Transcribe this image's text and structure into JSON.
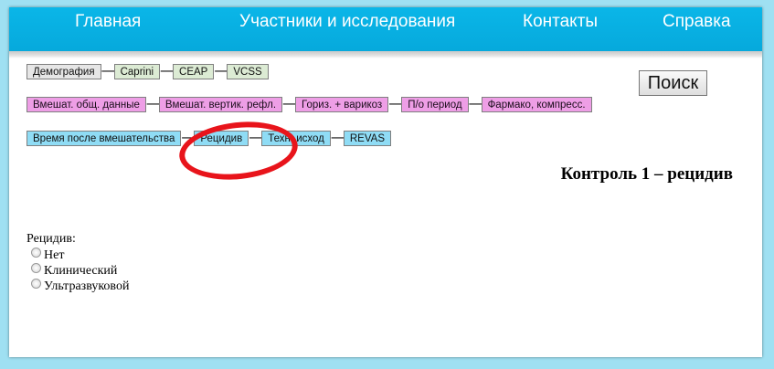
{
  "nav": {
    "items": [
      "Главная",
      "Участники и исследования",
      "Контакты",
      "Справка"
    ]
  },
  "breadcrumbs": {
    "row1": [
      "Демография",
      "Caprini",
      "CEAP",
      "VCSS"
    ],
    "row2": [
      "Вмешат. общ. данные",
      "Вмешат. вертик. рефл.",
      "Гориз. + варикоз",
      "П/о период",
      "Фармако, компресс."
    ],
    "row3": [
      "Время после вмешательства",
      "Рецидив",
      "Техн. исход",
      "REVAS"
    ],
    "arrow": "⟶"
  },
  "search": {
    "label": "Поиск"
  },
  "page": {
    "title": "Контроль 1 – рецидив"
  },
  "question": {
    "label": "Рецидив:",
    "options": [
      "Нет",
      "Клинический",
      "Ультразвуковой"
    ]
  },
  "colors": {
    "nav_bg": "#06a9dc",
    "grey_step": "#e6e6e6",
    "green_step": "#dcebd4",
    "pink_step": "#ee9ee6",
    "blue_step": "#8fdcf5",
    "annotation": "#e8141b"
  }
}
